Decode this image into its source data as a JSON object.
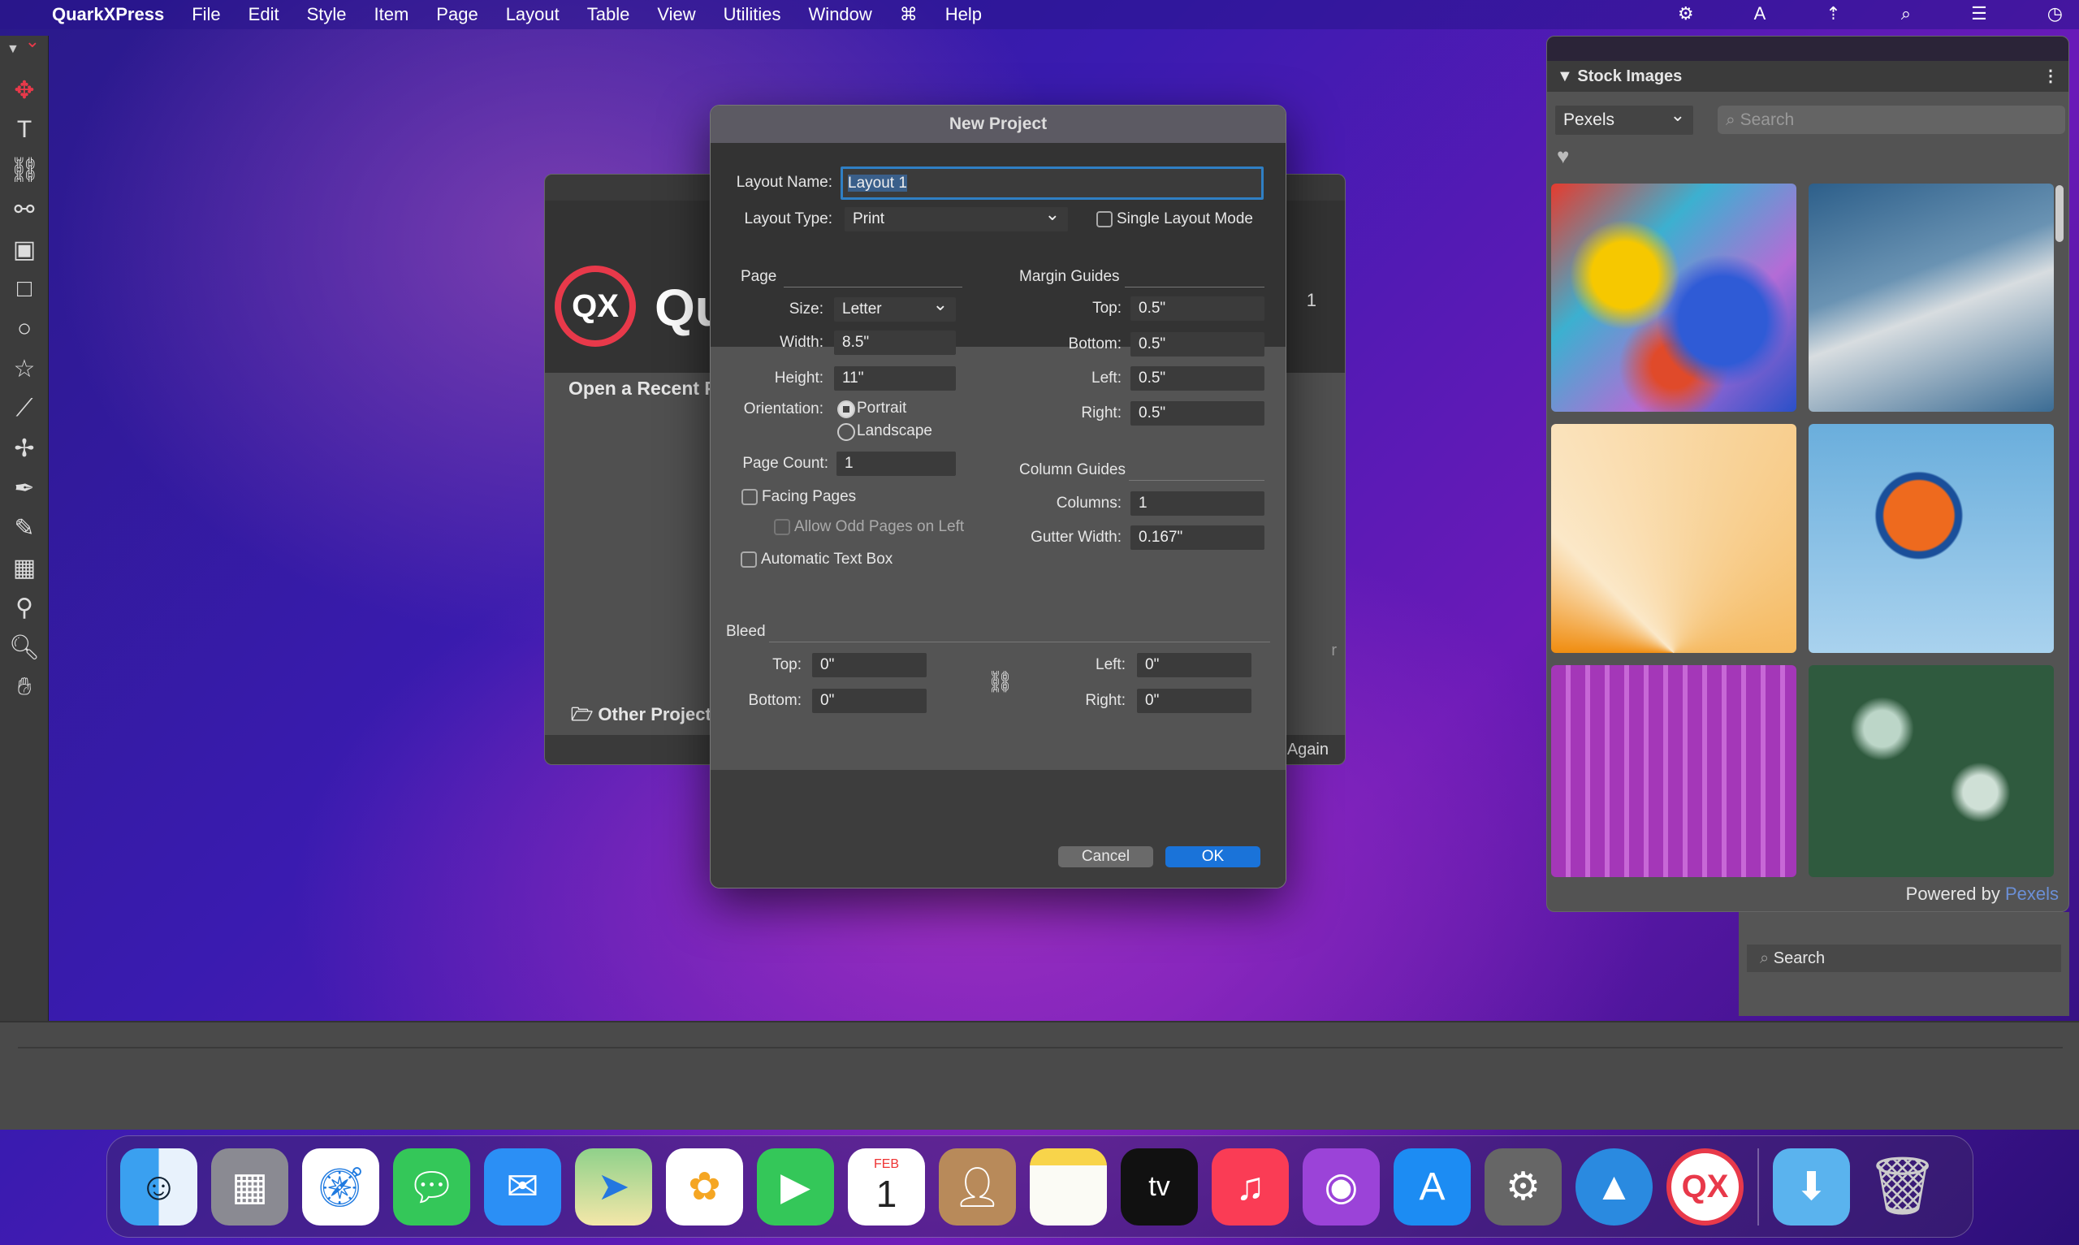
{
  "menubar": {
    "app": "QuarkXPress",
    "items": [
      "File",
      "Edit",
      "Style",
      "Item",
      "Page",
      "Layout",
      "Table",
      "View",
      "Utilities",
      "Window",
      "Help"
    ],
    "status_icons": [
      "gear-icon",
      "text-input-icon",
      "network-icon",
      "search-icon",
      "control-center-icon",
      "clock-icon"
    ]
  },
  "toolbar": {
    "tools": [
      "move",
      "text-content",
      "text-linking",
      "text-unlinking",
      "picture-content",
      "rectangle-box",
      "oval-box",
      "starburst",
      "line",
      "bezier-point",
      "pen",
      "pencil",
      "table",
      "eyedropper",
      "zoom",
      "pan"
    ]
  },
  "welcome": {
    "logo": "QX",
    "title_fragment": "Qu",
    "open_recent": "Open a Recent P",
    "other_project": "Other Project",
    "again": "Again",
    "version_fragment": "1",
    "side_fragment": "r"
  },
  "dialog": {
    "title": "New Project",
    "layout_name_label": "Layout Name:",
    "layout_name": "Layout 1",
    "layout_type_label": "Layout Type:",
    "layout_type": "Print",
    "single_layout_mode": "Single Layout Mode",
    "single_layout_mode_checked": false,
    "page": {
      "header": "Page",
      "size_label": "Size:",
      "size": "Letter",
      "width_label": "Width:",
      "width": "8.5\"",
      "height_label": "Height:",
      "height": "11\"",
      "orientation_label": "Orientation:",
      "portrait": "Portrait",
      "landscape": "Landscape",
      "orientation": "Portrait",
      "page_count_label": "Page Count:",
      "page_count": "1",
      "facing_pages": "Facing Pages",
      "allow_odd": "Allow Odd Pages on Left",
      "auto_text_box": "Automatic Text Box"
    },
    "margin": {
      "header": "Margin Guides",
      "top_label": "Top:",
      "top": "0.5\"",
      "bottom_label": "Bottom:",
      "bottom": "0.5\"",
      "left_label": "Left:",
      "left": "0.5\"",
      "right_label": "Right:",
      "right": "0.5\""
    },
    "columns": {
      "header": "Column Guides",
      "columns_label": "Columns:",
      "columns": "1",
      "gutter_label": "Gutter Width:",
      "gutter": "0.167\""
    },
    "bleed": {
      "header": "Bleed",
      "top_label": "Top:",
      "top": "0\"",
      "bottom_label": "Bottom:",
      "bottom": "0\"",
      "left_label": "Left:",
      "left": "0\"",
      "right_label": "Right:",
      "right": "0\""
    },
    "cancel": "Cancel",
    "ok": "OK",
    "accent": "#1a73d9"
  },
  "stock": {
    "title": "Stock Images",
    "source": "Pexels",
    "search_placeholder": "Search",
    "powered_by": "Powered by",
    "powered_link": "Pexels",
    "link_color": "#6b8fd6"
  },
  "lower_panel": {
    "search": "Search"
  },
  "dock": {
    "apps": [
      "finder",
      "launchpad",
      "safari",
      "messages",
      "mail",
      "maps",
      "photos",
      "facetime",
      "calendar",
      "contacts",
      "notes",
      "tv",
      "music",
      "podcasts",
      "app-store",
      "system-preferences",
      "mountain-app",
      "quarkxpress"
    ],
    "calendar_month": "FEB",
    "calendar_day": "1",
    "tv_label": "tv",
    "after_separator": [
      "downloads",
      "trash"
    ]
  }
}
